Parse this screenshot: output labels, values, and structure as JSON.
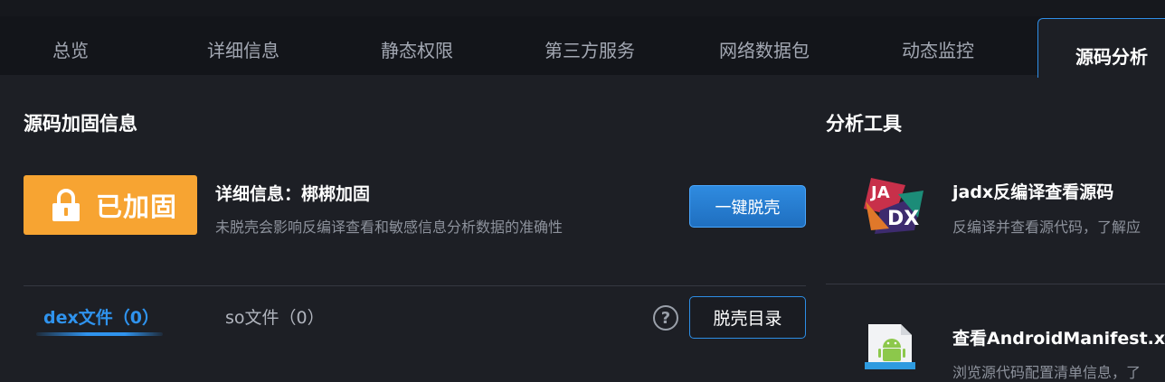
{
  "tabs": [
    "总览",
    "详细信息",
    "静态权限",
    "第三方服务",
    "网络数据包",
    "动态监控",
    "源码分析"
  ],
  "active_tab": "源码分析",
  "hardening": {
    "section_title": "源码加固信息",
    "badge_label": "已加固",
    "detail_title": "详细信息：梆梆加固",
    "detail_desc": "未脱壳会影响反编译查看和敏感信息分析数据的准确性",
    "unpack_button": "一键脱壳",
    "unpack_dir_button": "脱壳目录",
    "help_label": "?",
    "subtabs": [
      "dex文件（0）",
      "so文件（0）"
    ],
    "active_subtab": "dex文件（0）"
  },
  "tools": {
    "section_title": "分析工具",
    "items": [
      {
        "title": "jadx反编译查看源码",
        "desc": "反编译并查看源代码，了解应",
        "icon": "jadx-icon"
      },
      {
        "title": "查看AndroidManifest.x",
        "desc": "浏览源代码配置清单信息，了",
        "icon": "android-xml-icon"
      }
    ]
  },
  "colors": {
    "accent": "#2f93ee",
    "badge": "#f7a432",
    "background": "#1d1f25"
  }
}
